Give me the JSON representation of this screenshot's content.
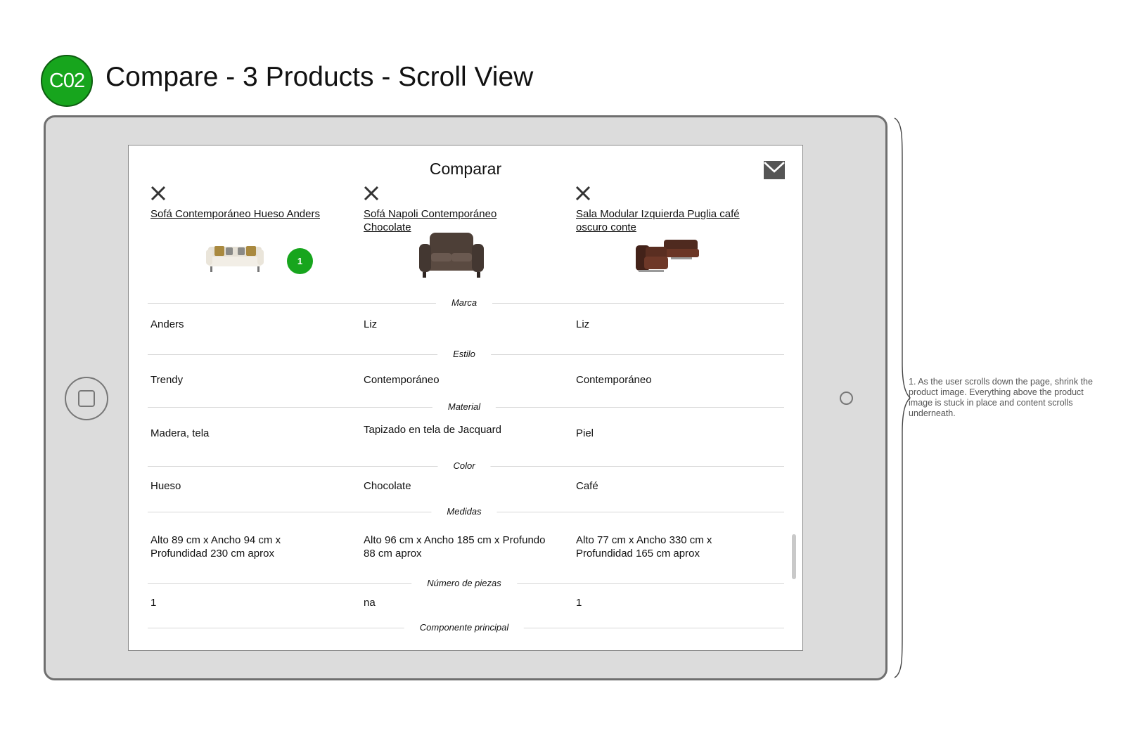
{
  "header": {
    "badge": "C02",
    "title": "Compare - 3 Products - Scroll View"
  },
  "screen": {
    "title": "Comparar",
    "share_icon": "mail-icon",
    "remove_icon": "close-icon"
  },
  "products": [
    {
      "name": "Sofá Contemporáneo Hueso Anders",
      "image": "white-sofa-image",
      "marker": "1"
    },
    {
      "name": "Sofá Napoli Contemporáneo Chocolate",
      "image": "brown-sofa-image"
    },
    {
      "name": "Sala Modular Izquierda Puglia café oscuro conte",
      "image": "sectional-sofa-image"
    }
  ],
  "attributes": [
    {
      "label": "Marca",
      "values": [
        "Anders",
        "Liz",
        "Liz"
      ]
    },
    {
      "label": "Estilo",
      "values": [
        "Trendy",
        "Contemporáneo",
        "Contemporáneo"
      ]
    },
    {
      "label": "Material",
      "values": [
        "Madera, tela",
        "Tapizado en tela de Jacquard",
        "Piel"
      ]
    },
    {
      "label": "Color",
      "values": [
        "Hueso",
        "Chocolate",
        "Café"
      ]
    },
    {
      "label": "Medidas",
      "values": [
        "Alto 89 cm x Ancho 94 cm x Profundidad 230 cm aprox",
        "Alto 96 cm x Ancho 185 cm x Profundo 88 cm aprox",
        "Alto 77 cm x Ancho 330 cm x Profundidad 165 cm aprox"
      ]
    },
    {
      "label": "Número de piezas",
      "values": [
        "1",
        "na",
        "1"
      ]
    },
    {
      "label": "Componente principal",
      "values": []
    }
  ],
  "annotation": "1. As the user scrolls down the page, shrink the product image. Everything above the product image is stuck in place and content scrolls underneath."
}
